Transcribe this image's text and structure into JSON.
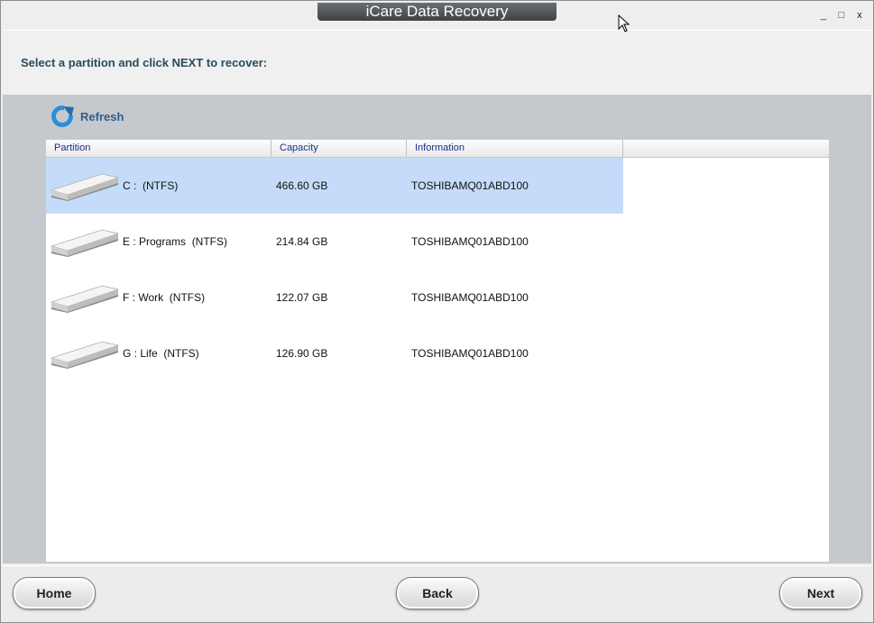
{
  "window": {
    "title": "iCare Data Recovery",
    "minimize_label": "_",
    "maximize_label": "□",
    "close_label": "x"
  },
  "header": {
    "instruction": "Select a partition and click NEXT to recover:"
  },
  "toolbar": {
    "refresh_label": "Refresh",
    "refresh_icon": "refresh-icon"
  },
  "table": {
    "columns": [
      "Partition",
      "Capacity",
      "Information"
    ],
    "rows": [
      {
        "partition": "C :  (NTFS)",
        "capacity": "466.60 GB",
        "information": "TOSHIBAMQ01ABD100",
        "selected": true
      },
      {
        "partition": "E : Programs  (NTFS)",
        "capacity": "214.84 GB",
        "information": "TOSHIBAMQ01ABD100",
        "selected": false
      },
      {
        "partition": "F : Work  (NTFS)",
        "capacity": "122.07 GB",
        "information": "TOSHIBAMQ01ABD100",
        "selected": false
      },
      {
        "partition": "G : Life  (NTFS)",
        "capacity": "126.90 GB",
        "information": "TOSHIBAMQ01ABD100",
        "selected": false
      }
    ]
  },
  "footer": {
    "home_label": "Home",
    "back_label": "Back",
    "next_label": "Next"
  },
  "colors": {
    "selection": "#c4dcfa",
    "accent": "#2e5f8a",
    "header_text": "#1a2f8a"
  }
}
